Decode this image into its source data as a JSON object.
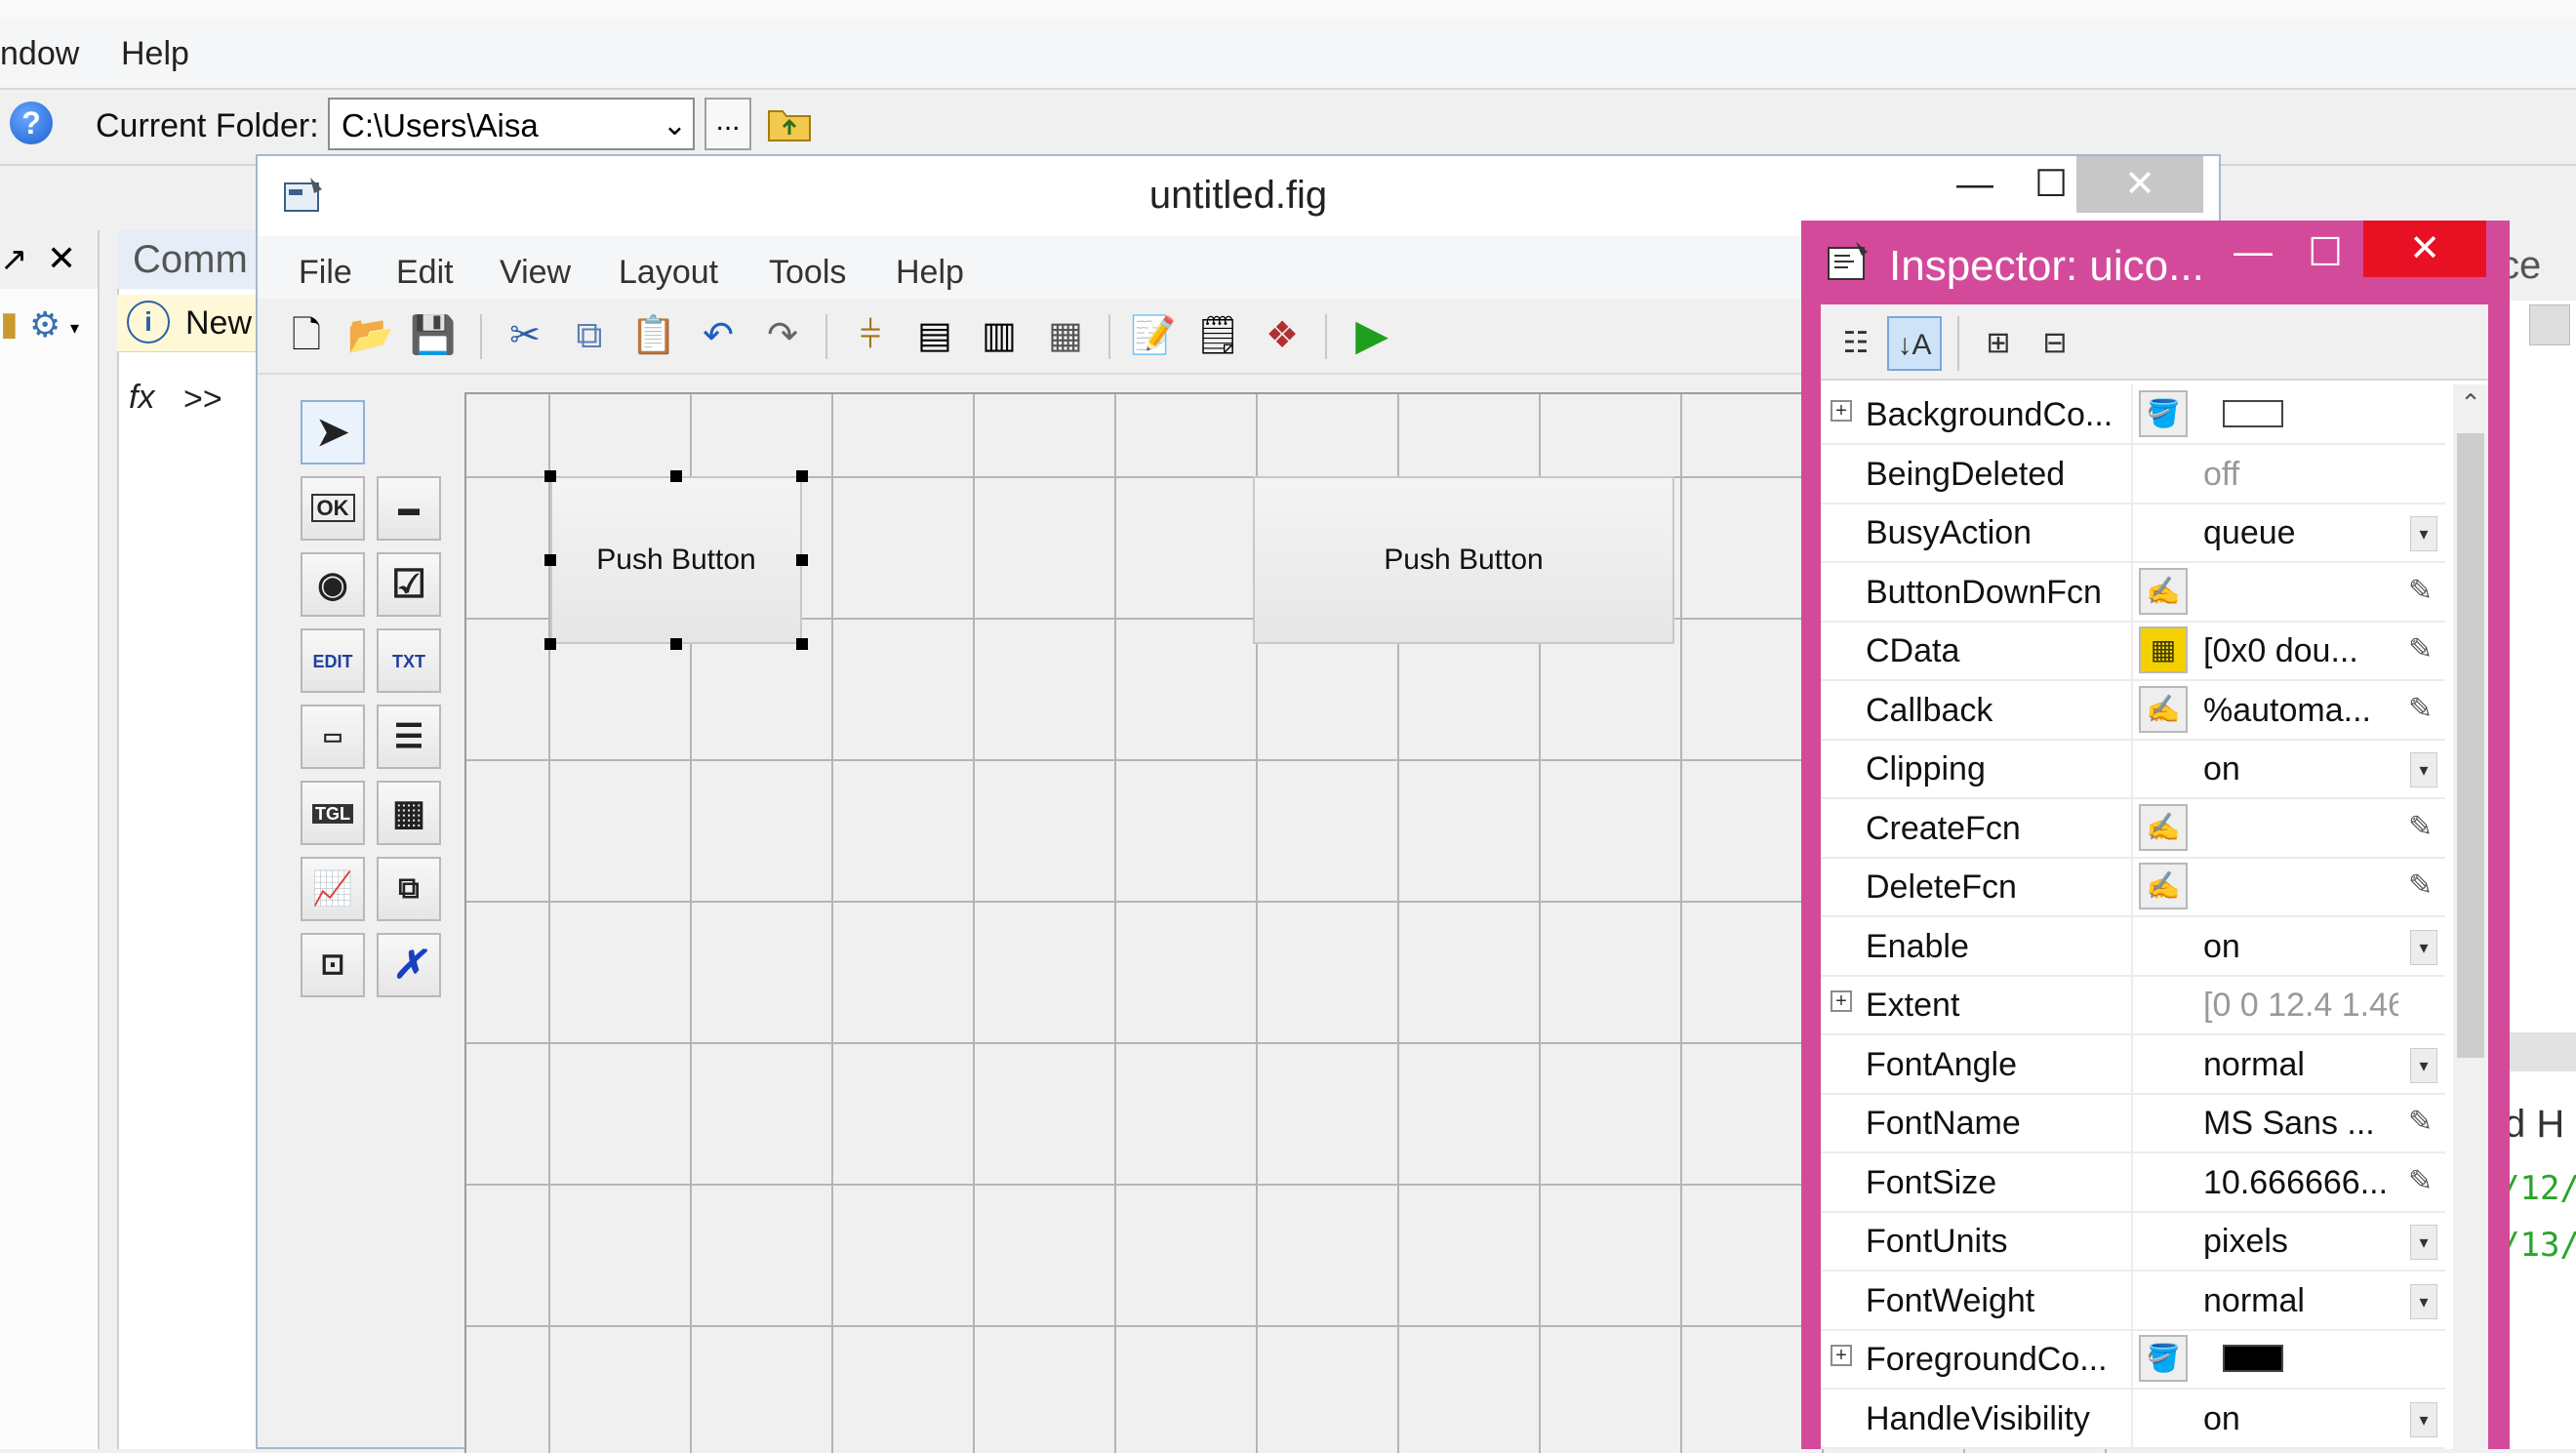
{
  "main_menu": {
    "window": "ndow",
    "help": "Help"
  },
  "folder_bar": {
    "label": "Current Folder:",
    "path": "C:\\Users\\Aisa",
    "browse": "..."
  },
  "left": {
    "command_tab": "Comm",
    "new_label": "New",
    "fx": "fx",
    "prompt": ">>"
  },
  "right_strip": {
    "header": "ce",
    "dh": "d H",
    "history": [
      "/12/",
      "/13/"
    ]
  },
  "guide": {
    "title": "untitled.fig",
    "menu": [
      "File",
      "Edit",
      "View",
      "Layout",
      "Tools",
      "Help"
    ],
    "buttons": [
      "Push Button",
      "Push Button"
    ],
    "palette": {
      "ok": "OK",
      "edit": "EDIT",
      "txt": "TXT",
      "tgl": "TGL"
    }
  },
  "inspector": {
    "title": "Inspector:  uico...",
    "properties": [
      {
        "name": "BackgroundCo...",
        "value": "",
        "icon": "paint-bucket-icon",
        "expand": true,
        "swatch": "#ffffff"
      },
      {
        "name": "BeingDeleted",
        "value": "off",
        "gray": true
      },
      {
        "name": "BusyAction",
        "value": "queue",
        "dropdown": true
      },
      {
        "name": "ButtonDownFcn",
        "value": "",
        "icon": "callback-pen-icon",
        "edit": true
      },
      {
        "name": "CData",
        "value": "[0x0  dou...",
        "icon": "grid-icon",
        "edit": true
      },
      {
        "name": "Callback",
        "value": "%automa...",
        "icon": "callback-pen-icon",
        "edit": true
      },
      {
        "name": "Clipping",
        "value": "on",
        "dropdown": true
      },
      {
        "name": "CreateFcn",
        "value": "",
        "icon": "callback-pen-icon",
        "edit": true
      },
      {
        "name": "DeleteFcn",
        "value": "",
        "icon": "callback-pen-icon",
        "edit": true
      },
      {
        "name": "Enable",
        "value": "on",
        "dropdown": true
      },
      {
        "name": "Extent",
        "value": "[0 0 12.4 1.46...",
        "expand": true,
        "gray": true
      },
      {
        "name": "FontAngle",
        "value": "normal",
        "dropdown": true
      },
      {
        "name": "FontName",
        "value": "MS Sans ...",
        "edit": true
      },
      {
        "name": "FontSize",
        "value": "10.666666...",
        "edit": true
      },
      {
        "name": "FontUnits",
        "value": "pixels",
        "dropdown": true
      },
      {
        "name": "FontWeight",
        "value": "normal",
        "dropdown": true
      },
      {
        "name": "ForegroundCo...",
        "value": "",
        "icon": "paint-bucket-icon",
        "expand": true,
        "swatch": "#000000"
      },
      {
        "name": "HandleVisibility",
        "value": "on",
        "dropdown": true
      }
    ]
  },
  "colors": {
    "inspector_frame": "#d44a9b",
    "close_red": "#e81123"
  }
}
